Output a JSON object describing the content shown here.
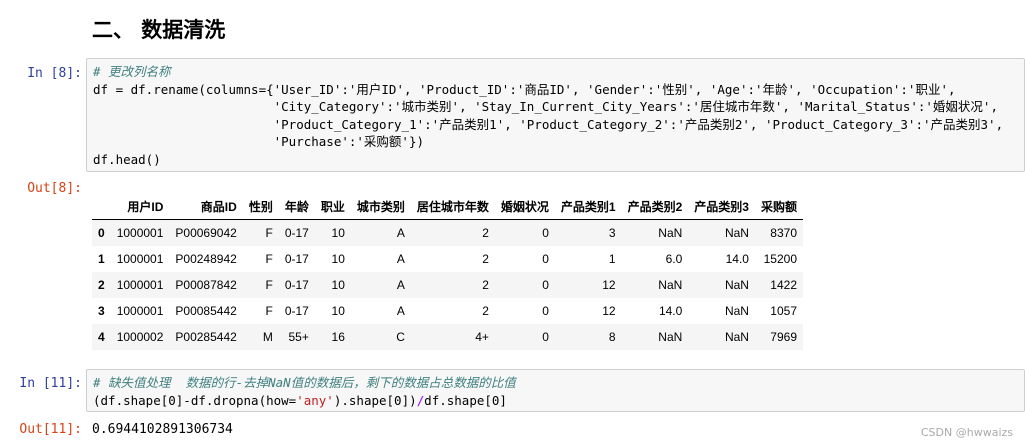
{
  "section_heading": "二、 数据清洗",
  "cells": [
    {
      "in_prompt": "In  [8]:",
      "comment": "# 更改列名称",
      "code_lines": [
        "df = df.rename(columns={'User_ID':'用户ID', 'Product_ID':'商品ID', 'Gender':'性别', 'Age':'年龄', 'Occupation':'职业',",
        "                        'City_Category':'城市类别', 'Stay_In_Current_City_Years':'居住城市年数', 'Marital_Status':'婚姻状况',",
        "                        'Product_Category_1':'产品类别1', 'Product_Category_2':'产品类别2', 'Product_Category_3':'产品类别3',",
        "                        'Purchase':'采购额'})",
        "df.head()"
      ],
      "out_prompt": "Out[8]:",
      "table": {
        "columns": [
          "",
          "用户ID",
          "商品ID",
          "性别",
          "年龄",
          "职业",
          "城市类别",
          "居住城市年数",
          "婚姻状况",
          "产品类别1",
          "产品类别2",
          "产品类别3",
          "采购额"
        ],
        "rows": [
          [
            "0",
            "1000001",
            "P00069042",
            "F",
            "0-17",
            "10",
            "A",
            "2",
            "0",
            "3",
            "NaN",
            "NaN",
            "8370"
          ],
          [
            "1",
            "1000001",
            "P00248942",
            "F",
            "0-17",
            "10",
            "A",
            "2",
            "0",
            "1",
            "6.0",
            "14.0",
            "15200"
          ],
          [
            "2",
            "1000001",
            "P00087842",
            "F",
            "0-17",
            "10",
            "A",
            "2",
            "0",
            "12",
            "NaN",
            "NaN",
            "1422"
          ],
          [
            "3",
            "1000001",
            "P00085442",
            "F",
            "0-17",
            "10",
            "A",
            "2",
            "0",
            "12",
            "14.0",
            "NaN",
            "1057"
          ],
          [
            "4",
            "1000002",
            "P00285442",
            "M",
            "55+",
            "16",
            "C",
            "4+",
            "0",
            "8",
            "NaN",
            "NaN",
            "7969"
          ]
        ]
      }
    },
    {
      "in_prompt": "In  [11]:",
      "comment": "# 缺失值处理  数据的行-去掉NaN值的数据后，剩下的数据占总数据的比值",
      "code_pre": "(df.shape[0]-df.dropna(how=",
      "code_str": "'any'",
      "code_mid": ").shape[0])",
      "code_op": "/",
      "code_post": "df.shape[0]",
      "out_prompt": "Out[11]:",
      "output": "0.6944102891306734"
    }
  ],
  "watermark": "CSDN @hwwaizs"
}
